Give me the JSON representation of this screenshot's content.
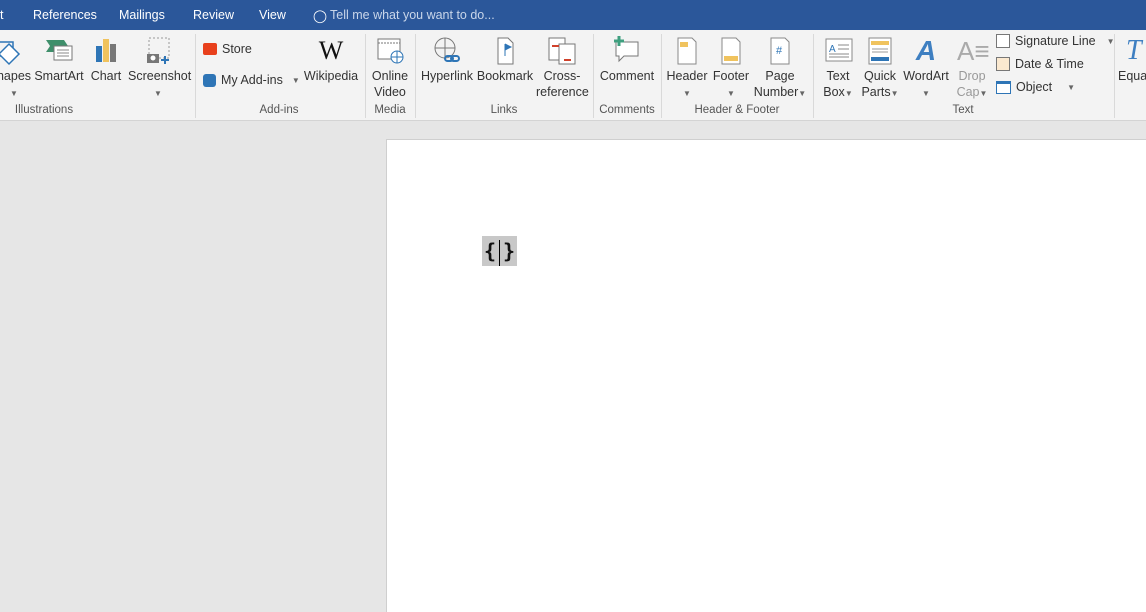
{
  "tabs": [
    "t",
    "References",
    "Mailings",
    "Review",
    "View"
  ],
  "tell_me": "Tell me what you want to do...",
  "ribbon": {
    "illustrations": {
      "label": "Illustrations",
      "shapes": "hapes",
      "smartart": "SmartArt",
      "chart": "Chart",
      "screenshot": "Screenshot"
    },
    "addins": {
      "label": "Add-ins",
      "store": "Store",
      "my_addins": "My Add-ins",
      "wikipedia": "Wikipedia",
      "wiki_logo": "W"
    },
    "media": {
      "label": "Media",
      "online_video": [
        "Online",
        "Video"
      ]
    },
    "links": {
      "label": "Links",
      "hyperlink": "Hyperlink",
      "bookmark": "Bookmark",
      "cross_reference": [
        "Cross-",
        "reference"
      ]
    },
    "comments": {
      "label": "Comments",
      "comment": "Comment"
    },
    "header_footer": {
      "label": "Header & Footer",
      "header": "Header",
      "footer": "Footer",
      "page_number": [
        "Page",
        "Number"
      ]
    },
    "text": {
      "label": "Text",
      "text_box": [
        "Text",
        "Box"
      ],
      "quick_parts": [
        "Quick",
        "Parts"
      ],
      "wordart": "WordArt",
      "drop_cap": [
        "Drop",
        "Cap"
      ],
      "signature_line": "Signature Line",
      "date_time": "Date & Time",
      "object": "Object"
    },
    "symbols": {
      "equation": "Equa"
    }
  },
  "document": {
    "field_open": "{",
    "field_close": "}"
  },
  "colors": {
    "ribbon_tab_bar": "#2b579a",
    "accent_blue": "#2e75b6"
  }
}
